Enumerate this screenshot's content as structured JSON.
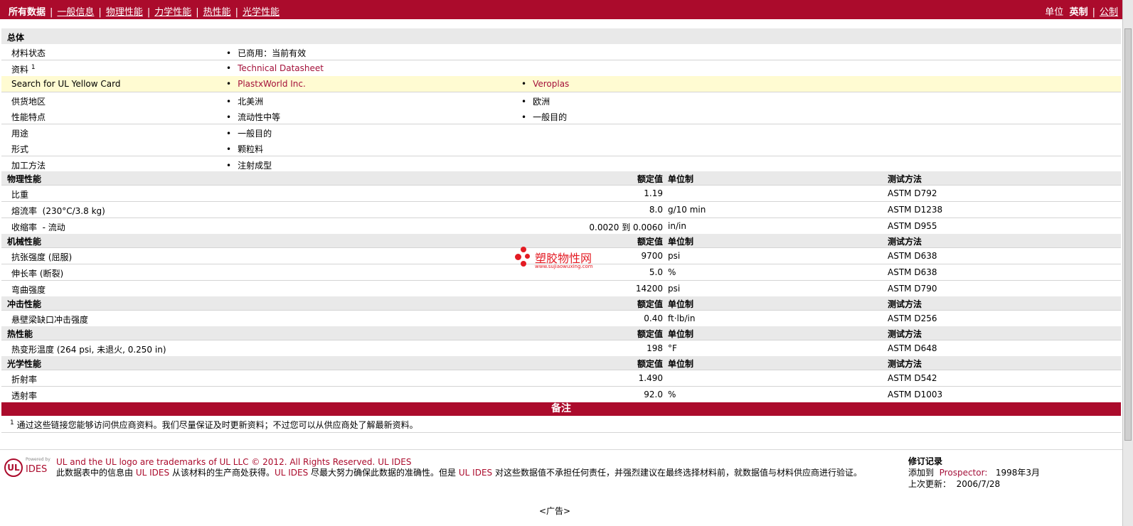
{
  "nav": {
    "items": [
      {
        "label": "所有数据",
        "active": true
      },
      {
        "label": "一般信息",
        "active": false
      },
      {
        "label": "物理性能",
        "active": false
      },
      {
        "label": "力学性能",
        "active": false
      },
      {
        "label": "热性能",
        "active": false
      },
      {
        "label": "光学性能",
        "active": false
      }
    ],
    "unit_label": "单位",
    "unit_imperial": "英制",
    "unit_metric": "公制"
  },
  "general": {
    "header": "总体",
    "material_status": {
      "label": "材料状态",
      "value": "已商用：当前有效"
    },
    "documents": {
      "label": "资料",
      "sup": "1",
      "value": "Technical Datasheet"
    },
    "ul_card": {
      "label": "Search for UL Yellow Card",
      "value1": "PlastxWorld Inc.",
      "value2": "Veroplas"
    },
    "region": {
      "label": "供货地区",
      "value1": "北美洲",
      "value2": "欧洲"
    },
    "features": {
      "label": "性能特点",
      "value1": "流动性中等",
      "value2": "一般目的"
    },
    "uses": {
      "label": "用途",
      "value1": "一般目的"
    },
    "form": {
      "label": "形式",
      "value1": "颗粒料"
    },
    "processing": {
      "label": "加工方法",
      "value1": "注射成型"
    }
  },
  "col_headers": {
    "nominal": "额定值",
    "unit": "单位制",
    "test": "测试方法"
  },
  "physical": {
    "header": "物理性能",
    "rows": [
      {
        "label": "比重",
        "cond": "",
        "value": "1.19",
        "unit": "",
        "test": "ASTM D792"
      },
      {
        "label": "熔流率",
        "cond": "(230°C/3.8 kg)",
        "value": "8.0",
        "unit": "g/10 min",
        "test": "ASTM D1238"
      },
      {
        "label": "收缩率",
        "cond": "- 流动",
        "value": "0.0020 到  0.0060",
        "unit": "in/in",
        "test": "ASTM D955"
      }
    ]
  },
  "mechanical": {
    "header": "机械性能",
    "rows": [
      {
        "label": "抗张强度",
        "cond": "(屈服)",
        "value": "9700",
        "unit": "psi",
        "test": "ASTM D638"
      },
      {
        "label": "伸长率",
        "cond": "(断裂)",
        "value": "5.0",
        "unit": "%",
        "test": "ASTM D638"
      },
      {
        "label": "弯曲强度",
        "cond": "",
        "value": "14200",
        "unit": "psi",
        "test": "ASTM D790"
      }
    ]
  },
  "impact": {
    "header": "冲击性能",
    "rows": [
      {
        "label": "悬壁梁缺口冲击强度",
        "cond": "",
        "value": "0.40",
        "unit": "ft·lb/in",
        "test": "ASTM D256"
      }
    ]
  },
  "thermal": {
    "header": "热性能",
    "rows": [
      {
        "label": "热变形温度",
        "cond": "(264 psi, 未退火, 0.250 in)",
        "value": "198",
        "unit": "°F",
        "test": "ASTM D648"
      }
    ]
  },
  "optical": {
    "header": "光学性能",
    "rows": [
      {
        "label": "折射率",
        "cond": "",
        "value": "1.490",
        "unit": "",
        "test": "ASTM D542"
      },
      {
        "label": "透射率",
        "cond": "",
        "value": "92.0",
        "unit": "%",
        "test": "ASTM D1003"
      }
    ]
  },
  "notes": {
    "header": "备注",
    "sup": "1",
    "text": "通过这些链接您能够访问供应商资料。我们尽量保证及时更新资料；不过您可以从供应商处了解最新资料。"
  },
  "footer": {
    "powered_by": "Powered by",
    "ides": "IDES",
    "trademark": "UL and the UL logo are trademarks of UL LLC © 2012. All Rights Reserved.",
    "ul_ides": "UL IDES",
    "disclaimer_a": "此数据表中的信息由",
    "disclaimer_b": "从该材料的生产商处获得。",
    "disclaimer_c": "尽最大努力确保此数据的准确性。但是",
    "disclaimer_d": "对这些数据值不承担任何责任，并强烈建议在最终选择材料前，就数据值与材料供应商进行验证。",
    "rev_title": "修订记录",
    "added_label": "添加到",
    "added_link": "Prospector:",
    "added_date": "1998年3月",
    "updated_label": "上次更新：",
    "updated_date": "2006/7/28",
    "ad": "<广告>"
  },
  "watermark": {
    "text": "塑胶物性网",
    "url": "www.sujiaowuxing.com"
  },
  "colors": {
    "brand": "#ab0b2c",
    "link": "#a4113a",
    "highlight": "#fffbd2"
  }
}
